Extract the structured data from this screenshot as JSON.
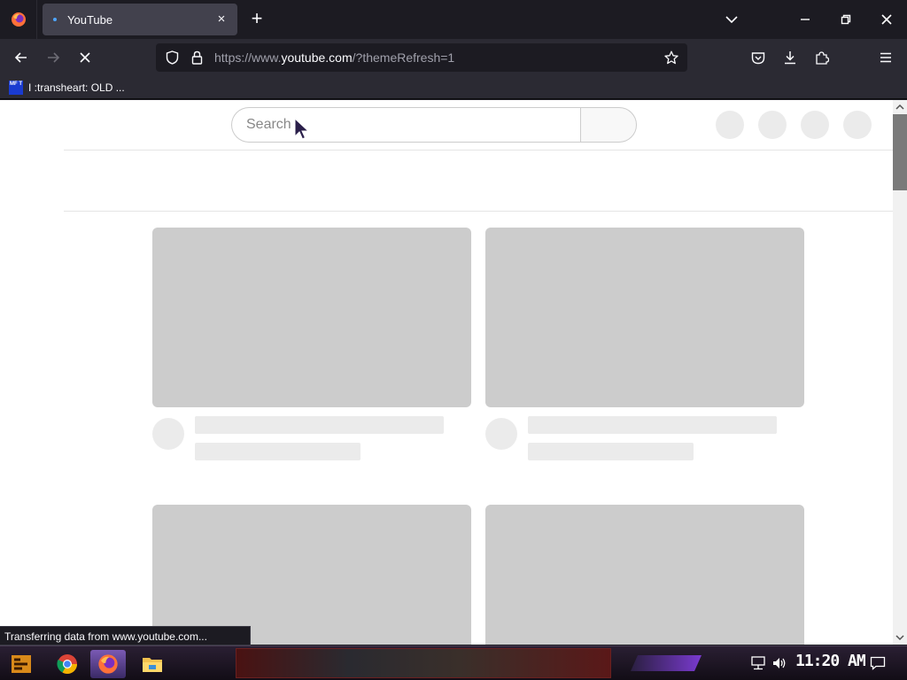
{
  "browser": {
    "tab_title": "YouTube",
    "tab_close_glyph": "×",
    "new_tab_glyph": "+",
    "url_prefix": "https://www.",
    "url_host": "youtube.com",
    "url_path": "/?themeRefresh=1",
    "bookmark_label": "I :transheart: OLD ...",
    "bookmark_favicon_text": "MF T",
    "status_text": "Transferring data from www.youtube.com..."
  },
  "icons": {
    "app_menu": "firefox-icon",
    "tab_list": "chevron-down-icon",
    "minimize": "minimize-icon",
    "maximize": "restore-icon",
    "close": "close-icon",
    "back": "back-arrow-icon",
    "forward": "forward-arrow-icon",
    "stop": "stop-icon",
    "tracking": "shield-icon",
    "lock": "lock-icon",
    "bookmark_star": "star-icon",
    "pocket": "pocket-icon",
    "downloads": "download-icon",
    "extensions": "puzzle-icon",
    "menu": "hamburger-icon"
  },
  "page": {
    "search_placeholder": "Search"
  },
  "taskbar": {
    "clock": "11:20 AM"
  },
  "colors": {
    "browser_dark": "#1c1b22",
    "toolbar": "#2b2a33",
    "skeleton_thumb": "#cccccc",
    "skeleton_line": "#ebebeb"
  }
}
